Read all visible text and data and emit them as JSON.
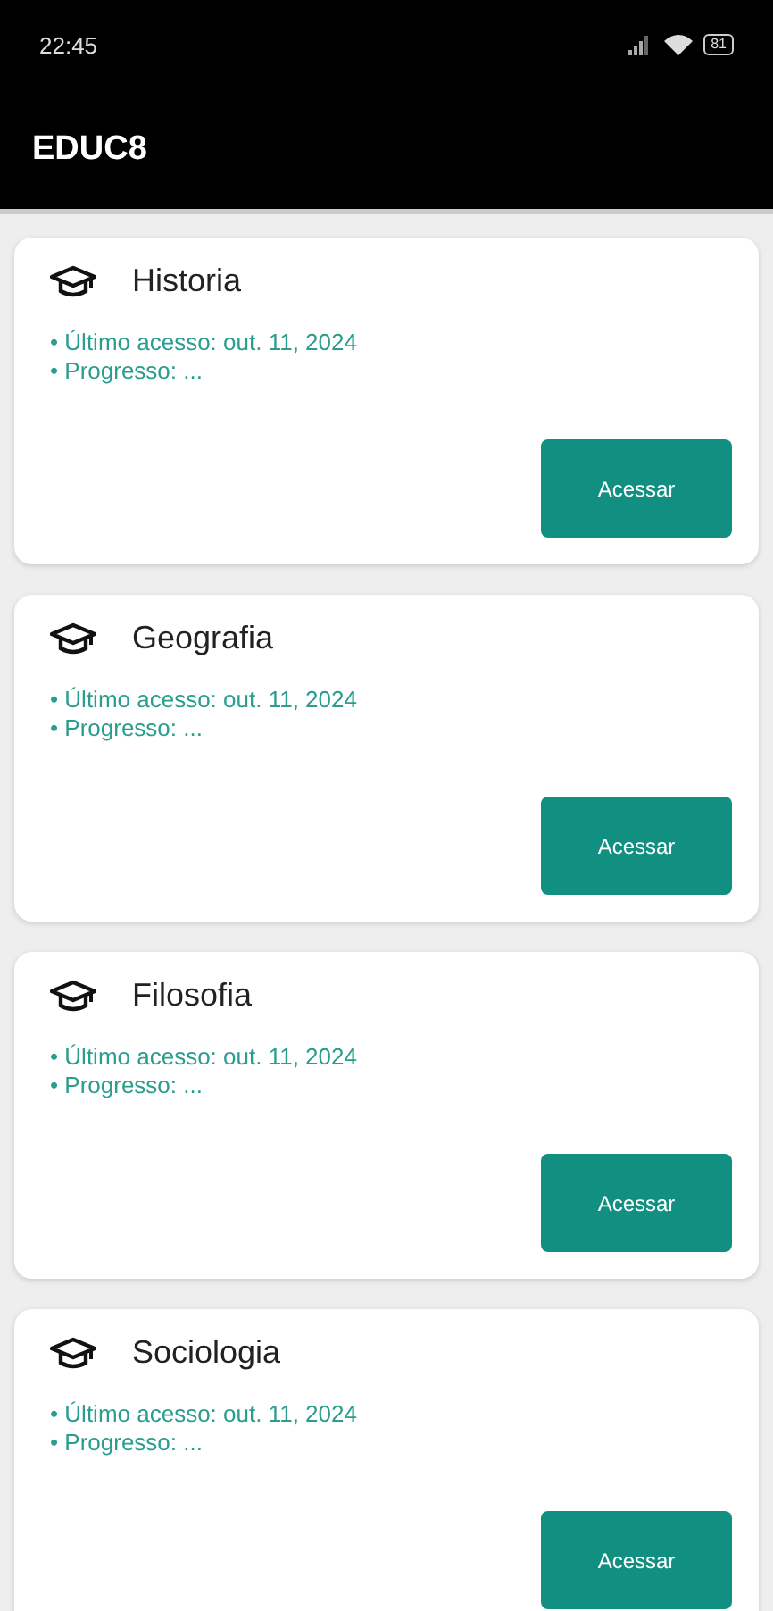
{
  "status_bar": {
    "time": "22:45",
    "battery": "81"
  },
  "app_bar": {
    "title": "EDUC8"
  },
  "courses": [
    {
      "title": "Historia",
      "details": [
        "• Último acesso: out. 11, 2024",
        "• Progresso: ..."
      ],
      "button": "Acessar"
    },
    {
      "title": "Geografia",
      "details": [
        "• Último acesso: out. 11, 2024",
        "• Progresso: ..."
      ],
      "button": "Acessar"
    },
    {
      "title": "Filosofia",
      "details": [
        "• Último acesso: out. 11, 2024",
        "• Progresso: ..."
      ],
      "button": "Acessar"
    },
    {
      "title": "Sociologia",
      "details": [
        "• Último acesso: out. 11, 2024",
        "• Progresso: ..."
      ],
      "button": "Acessar"
    }
  ]
}
